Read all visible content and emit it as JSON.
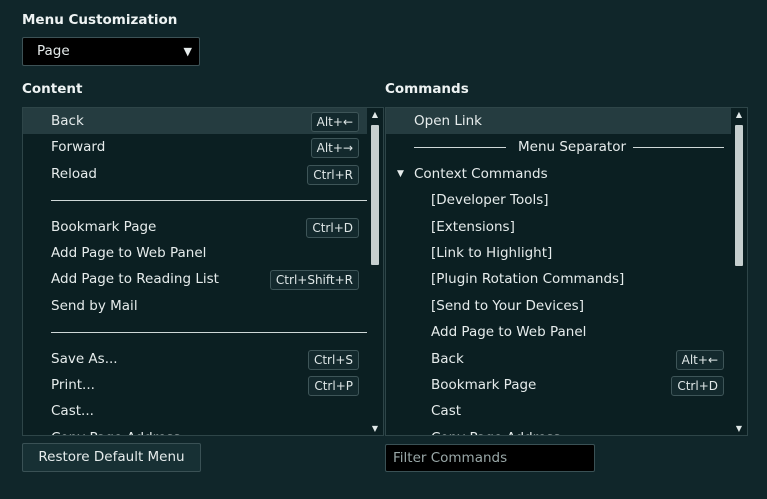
{
  "title": "Menu Customization",
  "menu_select": {
    "value": "Page"
  },
  "content": {
    "heading": "Content",
    "items": [
      {
        "label": "Back",
        "shortcut": "Alt+←",
        "selected": true
      },
      {
        "label": "Forward",
        "shortcut": "Alt+→"
      },
      {
        "label": "Reload",
        "shortcut": "Ctrl+R"
      },
      {
        "separator": true
      },
      {
        "label": "Bookmark Page",
        "shortcut": "Ctrl+D"
      },
      {
        "label": "Add Page to Web Panel"
      },
      {
        "label": "Add Page to Reading List",
        "shortcut": "Ctrl+Shift+R"
      },
      {
        "label": "Send by Mail"
      },
      {
        "separator": true
      },
      {
        "label": "Save As...",
        "shortcut": "Ctrl+S"
      },
      {
        "label": "Print...",
        "shortcut": "Ctrl+P"
      },
      {
        "label": "Cast..."
      },
      {
        "label": "Copy Page Address"
      }
    ]
  },
  "commands": {
    "heading": "Commands",
    "items": [
      {
        "label": "Open Link",
        "selected": true,
        "level": 0
      },
      {
        "label": "Menu Separator",
        "menu_separator": true
      },
      {
        "label": "Context Commands",
        "group": true,
        "level": 0
      },
      {
        "label": "[Developer Tools]",
        "level": 1
      },
      {
        "label": "[Extensions]",
        "level": 1
      },
      {
        "label": "[Link to Highlight]",
        "level": 1
      },
      {
        "label": "[Plugin Rotation Commands]",
        "level": 1
      },
      {
        "label": "[Send to Your Devices]",
        "level": 1
      },
      {
        "label": "Add Page to Web Panel",
        "level": 1
      },
      {
        "label": "Back",
        "shortcut": "Alt+←",
        "level": 1
      },
      {
        "label": "Bookmark Page",
        "shortcut": "Ctrl+D",
        "level": 1
      },
      {
        "label": "Cast",
        "level": 1
      },
      {
        "label": "Copy Page Address",
        "level": 1
      }
    ]
  },
  "restore_button": {
    "label": "Restore Default Menu"
  },
  "filter": {
    "placeholder": "Filter Commands"
  },
  "icons": {
    "dropdown": "dropdown-arrow-icon",
    "expanded": "expanded-triangle-icon",
    "scroll_up": "scroll-up-arrow-icon",
    "scroll_down": "scroll-down-arrow-icon"
  }
}
